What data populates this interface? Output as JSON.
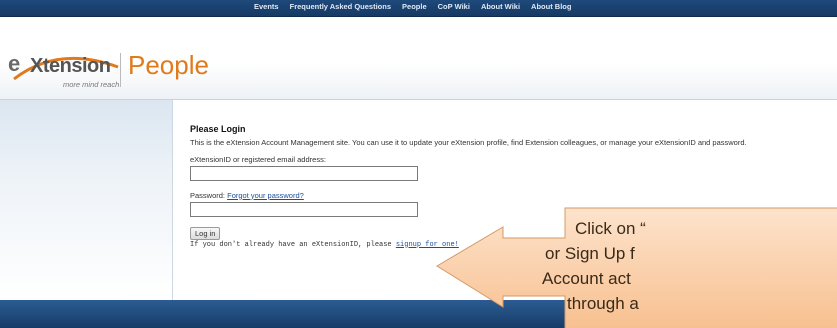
{
  "nav": {
    "links": [
      "Events",
      "Frequently Asked Questions",
      "People",
      "CoP Wiki",
      "About Wiki",
      "About Blog"
    ]
  },
  "logo": {
    "brand_e": "e",
    "brand_word": "Xtension",
    "tagline": "more mind reach",
    "site_name": "People"
  },
  "login": {
    "title": "Please Login",
    "intro": "This is the eXtension Account Management site. You can use it to update your eXtension profile, find Extension colleagues, or manage your eXtensionID and password.",
    "id_label": "eXtensionID or registered email address:",
    "id_value": "",
    "password_label": "Password:",
    "forgot_link": "Forgot your password?",
    "password_value": "",
    "button_label": "Log in",
    "signup_prefix": "If you don't already have an eXtensionID, please ",
    "signup_link": "signup for one!"
  },
  "callout": {
    "lines": [
      "Click on “",
      "or Sign Up f",
      "Account act",
      "through a"
    ]
  },
  "colors": {
    "nav_bg": "#1e4a7c",
    "accent_orange": "#e07a1c",
    "link_blue": "#1a4f9c",
    "callout_fill": "#fbd2ae"
  }
}
